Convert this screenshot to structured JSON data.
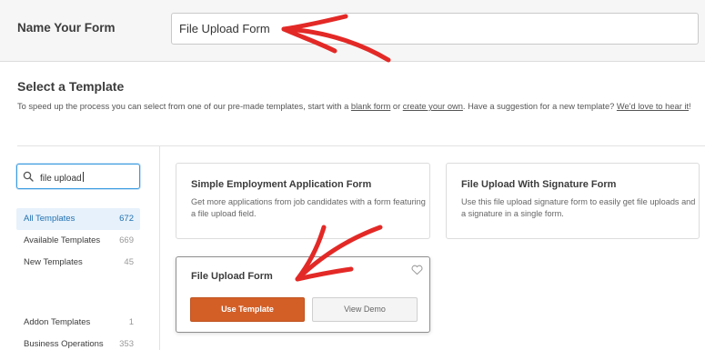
{
  "header": {
    "form_name_label": "Name Your Form",
    "form_name_value": "File Upload Form"
  },
  "template_section": {
    "title": "Select a Template",
    "desc_part1": "To speed up the process you can select from one of our pre-made templates, start with a ",
    "link_blank_form": "blank form",
    "desc_part2": " or ",
    "link_create_own": "create your own",
    "desc_part3": ". Have a suggestion for a new template? ",
    "link_love_to_hear": "We'd love to hear it",
    "desc_part4": "!"
  },
  "search": {
    "value": "file upload",
    "icon": "search-icon"
  },
  "categories": [
    {
      "label": "All Templates",
      "count": "672",
      "active": true
    },
    {
      "label": "Available Templates",
      "count": "669",
      "active": false
    },
    {
      "label": "New Templates",
      "count": "45",
      "active": false
    },
    {
      "label": "Addon Templates",
      "count": "1",
      "active": false
    },
    {
      "label": "Business Operations",
      "count": "353",
      "active": false
    }
  ],
  "cards": [
    {
      "title": "Simple Employment Application Form",
      "description": "Get more applications from job candidates with a form featuring a file upload field."
    },
    {
      "title": "File Upload With Signature Form",
      "description": "Use this file upload signature form to easily get file uploads and a signature in a single form."
    },
    {
      "title": "File Upload Form",
      "use_template_label": "Use Template",
      "view_demo_label": "View Demo"
    }
  ],
  "colors": {
    "accent_orange": "#d35f27",
    "annotation_red": "#e32926",
    "active_blue": "#2271b1"
  }
}
